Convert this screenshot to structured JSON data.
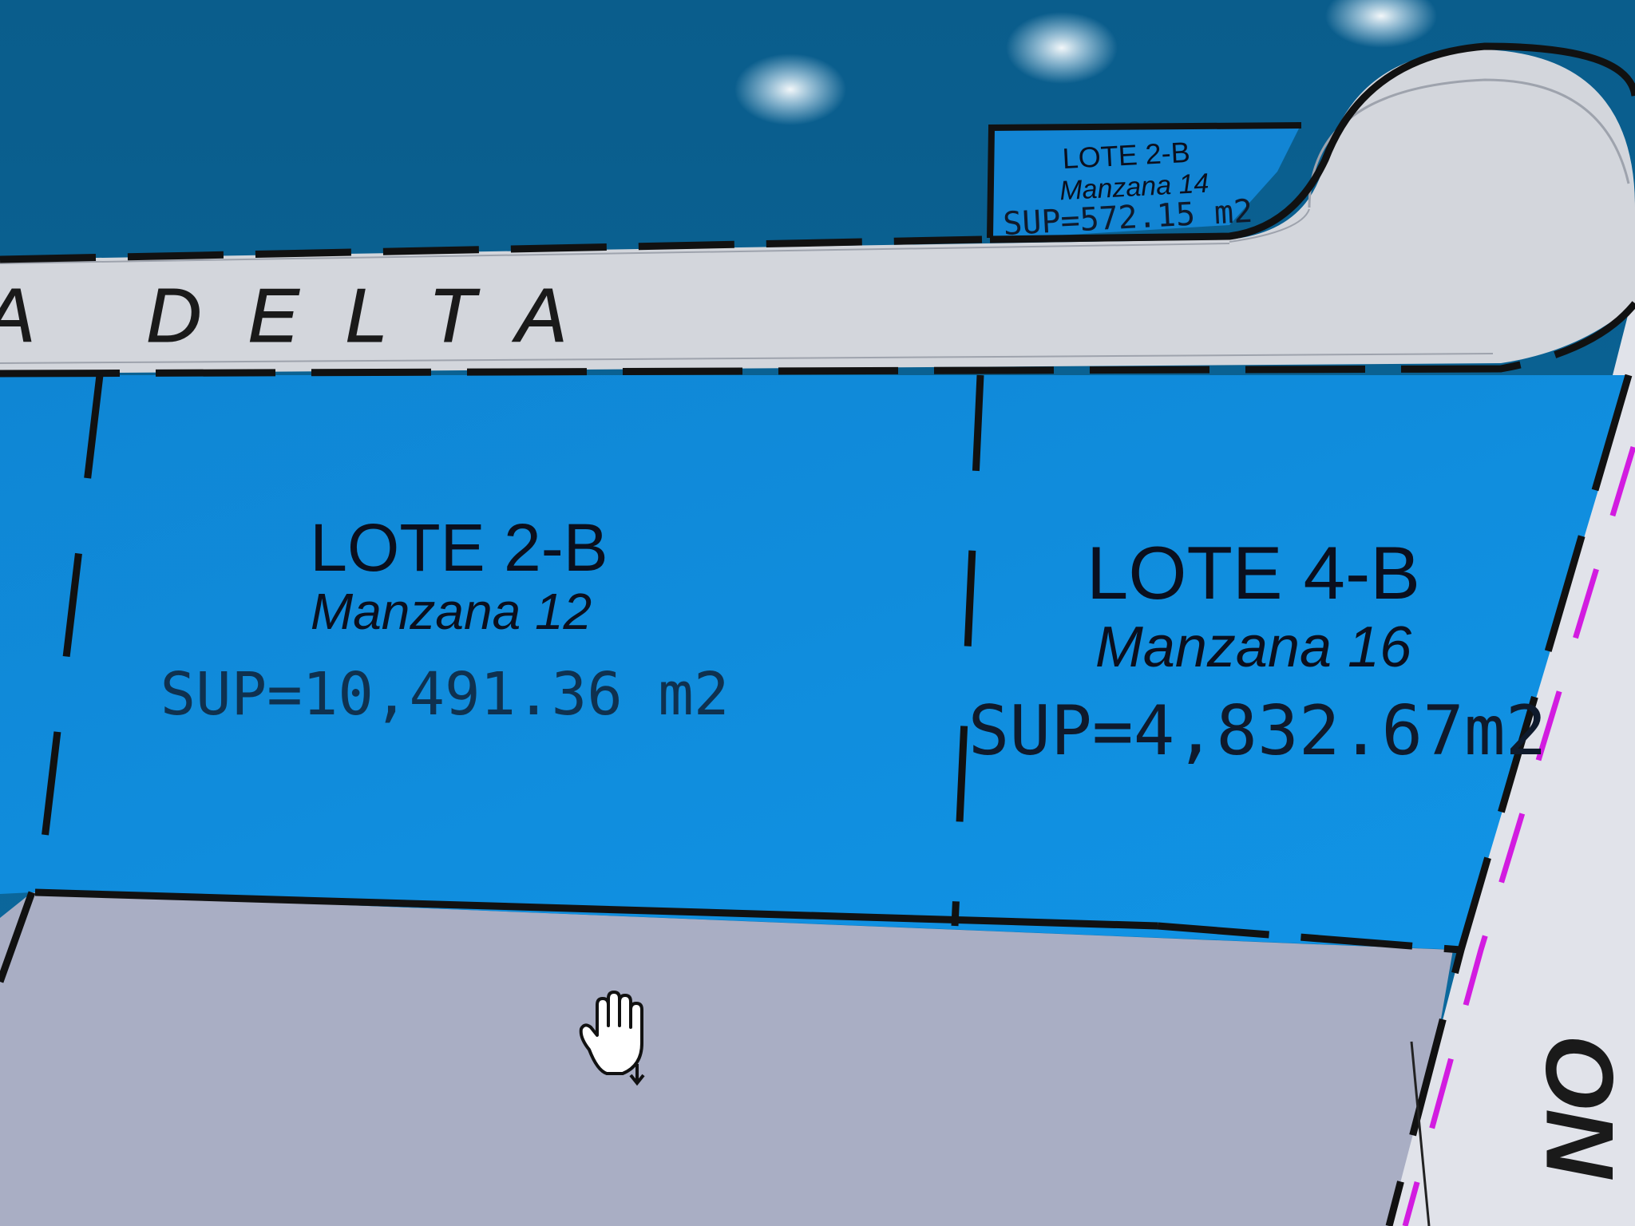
{
  "street": {
    "name": "A DELTA"
  },
  "lots": [
    {
      "id": "lote-2b-manzana-14",
      "title": "LOTE 2-B",
      "manzana": "Manzana 14",
      "sup": "SUP=572.15 m2"
    },
    {
      "id": "lote-2b-manzana-12",
      "title": "LOTE 2-B",
      "manzana": "Manzana 12",
      "sup": "SUP=10,491.36 m2"
    },
    {
      "id": "lote-4b-manzana-16",
      "title": "LOTE 4-B",
      "manzana": "Manzana 16",
      "sup": "SUP=4,832.67m2"
    }
  ],
  "side_street_partial": "NO",
  "colors": {
    "lot_fill": "#0f8fe0",
    "background": "#0b5f8f",
    "road": "#d3d6dc",
    "lower_area": "#a9aec4",
    "boundary": "#111111",
    "magenta_dash": "#d21ce0"
  },
  "cursor": {
    "icon": "hand-pan-icon"
  }
}
